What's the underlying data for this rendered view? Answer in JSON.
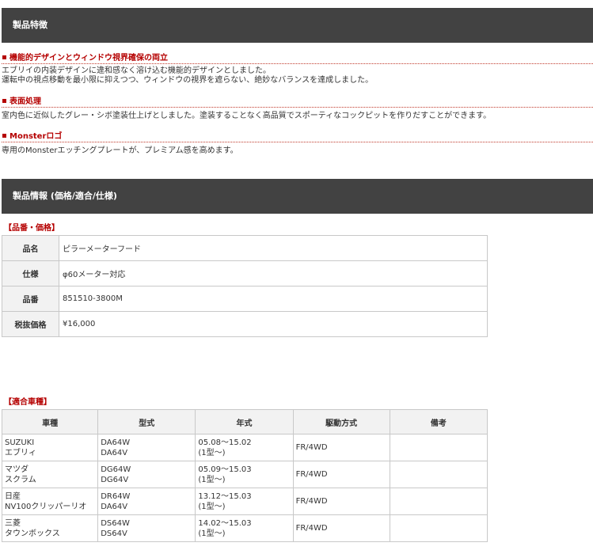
{
  "features": {
    "header": "製品特徴",
    "items": [
      {
        "title": "機能的デザインとウィンドウ視界確保の両立",
        "lines": [
          "エブリイの内装デザインに違和感なく溶け込む機能的デザインとしました。",
          "運転中の視点移動を最小限に抑えつつ、ウィンドウの視界を遮らない、絶妙なバランスを達成しました。"
        ]
      },
      {
        "title": "表面処理",
        "lines": [
          "室内色に近似したグレー・シボ塗装仕上げとしました。塗装することなく高品質でスポーティなコックピットを作りだすことができます。"
        ]
      },
      {
        "title": "Monsterロゴ",
        "lines": [
          "専用のMonsterエッチングプレートが、プレミアム感を高めます。"
        ]
      }
    ]
  },
  "info": {
    "header": "製品情報 (価格/適合/仕様)",
    "price_label": "【品番・価格】",
    "spec_rows": [
      {
        "label": "品名",
        "value": "ピラーメーターフード"
      },
      {
        "label": "仕様",
        "value": "φ60メーター対応"
      },
      {
        "label": "品番",
        "value": "851510-3800M"
      },
      {
        "label": "税抜価格",
        "value": "¥16,000"
      }
    ],
    "fit_label": "【適合車種】",
    "fit_headers": [
      "車種",
      "型式",
      "年式",
      "駆動方式",
      "備考"
    ],
    "fit_rows": [
      {
        "maker": "SUZUKI",
        "model": "エブリィ",
        "code1": "DA64W",
        "code2": "DA64V",
        "year1": "05.08～15.02",
        "year2": "(1型～)",
        "drive": "FR/4WD",
        "note": ""
      },
      {
        "maker": "マツダ",
        "model": "スクラム",
        "code1": "DG64W",
        "code2": "DG64V",
        "year1": "05.09～15.03",
        "year2": "(1型～)",
        "drive": "FR/4WD",
        "note": ""
      },
      {
        "maker": "日産",
        "model": "NV100クリッパーリオ",
        "code1": "DR64W",
        "code2": "DA64V",
        "year1": "13.12～15.03",
        "year2": "(1型～)",
        "drive": "FR/4WD",
        "note": ""
      },
      {
        "maker": "三菱",
        "model": "タウンボックス",
        "code1": "DS64W",
        "code2": "DS64V",
        "year1": "14.02～15.03",
        "year2": "(1型～)",
        "drive": "FR/4WD",
        "note": ""
      }
    ]
  }
}
